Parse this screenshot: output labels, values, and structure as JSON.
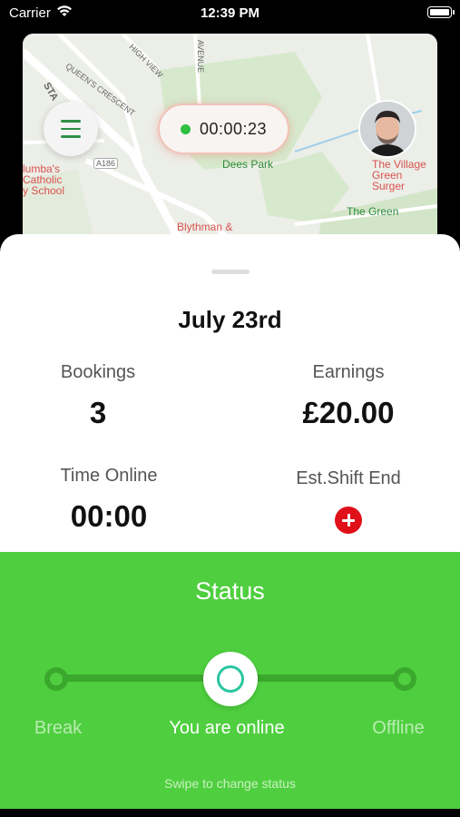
{
  "status_bar": {
    "carrier": "Carrier",
    "time": "12:39 PM"
  },
  "map": {
    "labels": {
      "road_high_view": "HIGH VIEW",
      "road_avenue": "AVENUE",
      "road_queens_crescent": "QUEEN'S CRESCENT",
      "road_sta": "STA",
      "road_a186": "A186",
      "school": "lumba's\nCatholic\ny School",
      "park": "Dees Park",
      "surgery": "The Village\nGreen Surger",
      "the_green": "The Green",
      "blythman": "Blythman &"
    },
    "timer": "00:00:23"
  },
  "summary": {
    "date": "July 23rd",
    "bookings_label": "Bookings",
    "bookings_value": "3",
    "earnings_label": "Earnings",
    "earnings_value": "£20.00",
    "time_online_label": "Time Online",
    "time_online_value": "00:00",
    "shift_end_label": "Est.Shift End"
  },
  "status": {
    "title": "Status",
    "options": [
      "Break",
      "You are online",
      "Offline"
    ],
    "active_option": "You are online",
    "hint": "Swipe to change status"
  },
  "colors": {
    "accent_green": "#4fcf3f",
    "track_green": "#3aa72d",
    "timer_dot": "#2fbf42",
    "add_red": "#e0101a"
  }
}
